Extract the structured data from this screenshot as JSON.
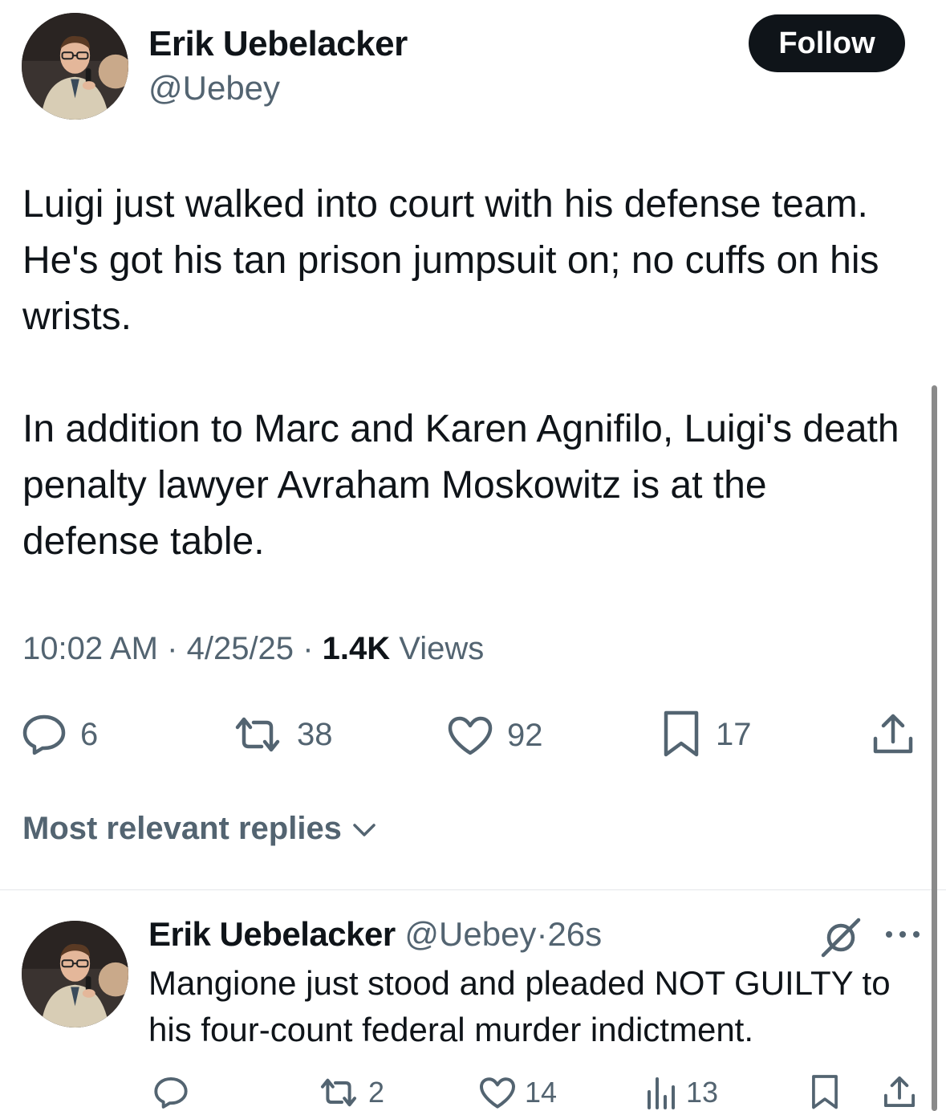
{
  "tweet": {
    "author": {
      "name": "Erik Uebelacker",
      "handle": "@Uebey",
      "follow_label": "Follow"
    },
    "paragraphs": [
      "Luigi just walked into court with his defense team. He's got his tan prison jumpsuit on; no cuffs on his wrists.",
      "In addition to Marc and Karen Agnifilo, Luigi's death penalty lawyer Avraham Moskowitz is at the defense table."
    ],
    "meta": {
      "time": "10:02 AM",
      "date": "4/25/25",
      "separator": "·",
      "views_count": "1.4K",
      "views_label": "Views"
    },
    "actions": {
      "replies": "6",
      "reposts": "38",
      "likes": "92",
      "bookmarks": "17"
    }
  },
  "replies_section": {
    "sort_label": "Most relevant replies"
  },
  "reply": {
    "name": "Erik Uebelacker",
    "handle": "@Uebey",
    "separator": "·",
    "age": "26s",
    "text": "Mangione just stood and pleaded NOT GUILTY to his four-count federal murder indictment.",
    "actions": {
      "reposts": "2",
      "likes": "14",
      "views": "13"
    }
  },
  "colors": {
    "text_primary": "#0f1419",
    "text_secondary": "#536471",
    "follow_bg": "#0f1419"
  },
  "icons": [
    "reply-icon",
    "repost-icon",
    "like-icon",
    "bookmark-icon",
    "share-icon",
    "views-icon",
    "grok-icon",
    "more-icon",
    "chevron-down-icon"
  ]
}
